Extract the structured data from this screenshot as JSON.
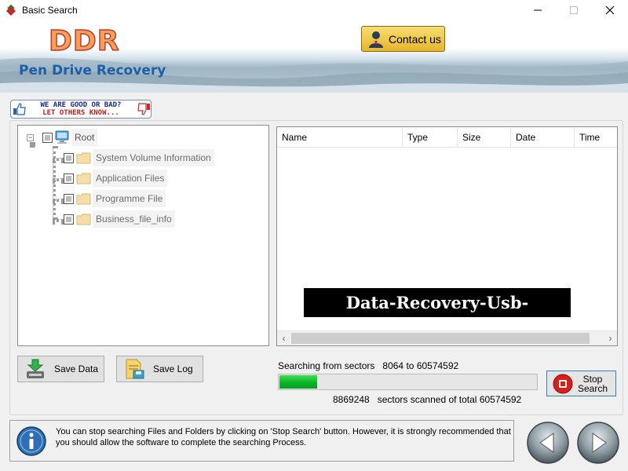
{
  "window": {
    "title": "Basic Search",
    "minimize_glyph": "—",
    "maximize_glyph": "☐",
    "close_glyph": "✕"
  },
  "banner": {
    "logo": "DDR",
    "product_name": "Pen Drive Recovery",
    "contact_label": "Contact us"
  },
  "rating_badge": {
    "line1": "WE ARE GOOD OR BAD?",
    "line2": "LET OTHERS KNOW..."
  },
  "tree": {
    "root_label": "Root",
    "expander_glyph": "−",
    "children": [
      {
        "label": "System Volume Information"
      },
      {
        "label": "Application Files"
      },
      {
        "label": "Programme File"
      },
      {
        "label": "Business_file_info"
      }
    ]
  },
  "list": {
    "columns": [
      "Name",
      "Type",
      "Size",
      "Date",
      "Time"
    ],
    "watermark": "Data-Recovery-Usb-Drive.com",
    "scroll_left": "‹",
    "scroll_right": "›"
  },
  "buttons": {
    "save_data": "Save Data",
    "save_log": "Save Log",
    "stop_search_line1": "Stop",
    "stop_search_line2": "Search"
  },
  "progress": {
    "searching_label": "Searching from sectors",
    "sector_from": "8064",
    "to_word": "to",
    "sector_to": "60574592",
    "scanned": "8869248",
    "scanned_text": "sectors scanned of total",
    "total": "60574592",
    "fraction": 0.146
  },
  "info": {
    "message": "You can stop searching Files and Folders by clicking on 'Stop Search' button. However, it is strongly recommended that you should allow the software to complete the searching Process."
  },
  "colors": {
    "logo": "#f5a15a",
    "product_name": "#1d5fa8",
    "progress": "#06b025",
    "contact": "#e6b62b"
  }
}
